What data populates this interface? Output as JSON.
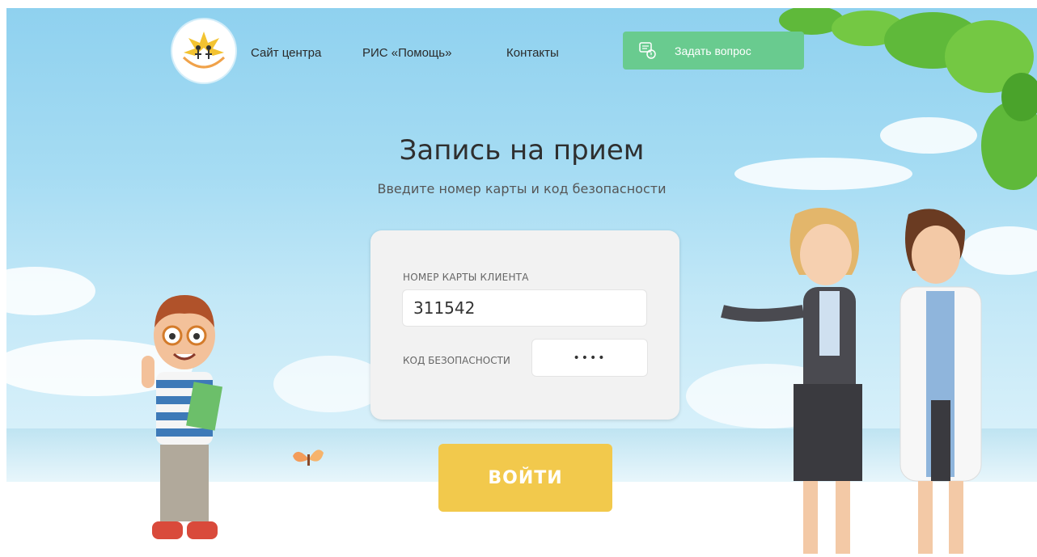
{
  "nav": {
    "items": [
      {
        "label": "Сайт центра"
      },
      {
        "label": "РИС «Помощь»"
      },
      {
        "label": "Контакты"
      }
    ],
    "ask_button": "Задать вопрос"
  },
  "main": {
    "title": "Запись на прием",
    "subtitle": "Введите номер карты и код безопасности",
    "card_label": "НОМЕР КАРТЫ КЛИЕНТА",
    "card_value": "311542",
    "code_label": "КОД БЕЗОПАСНОСТИ",
    "code_value": "••••",
    "login_button": "ВОЙТИ"
  },
  "colors": {
    "ask_button": "#69cb8f",
    "login_button": "#f2c94c",
    "sky": "#a6dcf3"
  },
  "icons": [
    "logo-hands-family-icon",
    "chat-question-icon",
    "butterfly-icon",
    "tree-leaves-icon"
  ]
}
